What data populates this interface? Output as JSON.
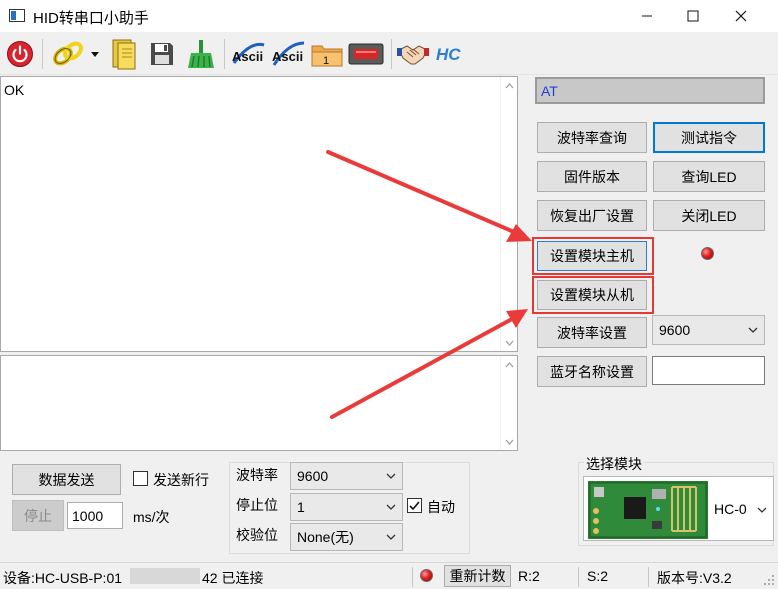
{
  "window": {
    "title": "HID转串口小助手",
    "controls": {
      "minimize": "—",
      "maximize": "☐",
      "close": "✕"
    }
  },
  "toolbar": {
    "icons": [
      "power-icon",
      "link-chain-icon",
      "dropdown-arrow-icon",
      "open-file-icon",
      "save-icon",
      "clear-broom-icon",
      "ascii-send-icon",
      "ascii-receive-icon",
      "folder-icon",
      "device-icon",
      "handshake-icon",
      "hc-logo-icon"
    ],
    "ascii1": "Ascii",
    "ascii2": "Ascii",
    "folder_badge": "1",
    "hc_logo": "HC"
  },
  "receive": {
    "text": "OK"
  },
  "send": {
    "text": ""
  },
  "command": {
    "value": "AT"
  },
  "buttons": {
    "baud_query": "波特率查询",
    "test_cmd": "测试指令",
    "firmware": "固件版本",
    "query_led": "查询LED",
    "factory_reset": "恢复出厂设置",
    "close_led": "关闭LED",
    "set_master": "设置模块主机",
    "set_slave": "设置模块从机",
    "baud_set": "波特率设置",
    "bt_name_set": "蓝牙名称设置",
    "send_data": "数据发送",
    "stop": "停止",
    "reset_count": "重新计数"
  },
  "baud_set_value": "9600",
  "bt_name_value": "",
  "send_options": {
    "newline_label": "发送新行",
    "newline_checked": false,
    "interval_value": "1000",
    "interval_unit": "ms/次"
  },
  "serial": {
    "baud_label": "波特率",
    "baud_value": "9600",
    "stop_label": "停止位",
    "stop_value": "1",
    "auto_label": "自动",
    "auto_checked": true,
    "parity_label": "校验位",
    "parity_value": "None(无)"
  },
  "module": {
    "group_label": "选择模块",
    "selected": "HC-0"
  },
  "status": {
    "device_prefix": "设备:HC-USB-P:01",
    "device_suffix": "42 已连接",
    "rx": "R:2",
    "tx": "S:2",
    "version": "版本号:V3.2"
  },
  "colors": {
    "accent": "#0078d7",
    "annotation_red": "#e53935",
    "command_text": "#1f3fd6",
    "led_red": "#e02020"
  }
}
